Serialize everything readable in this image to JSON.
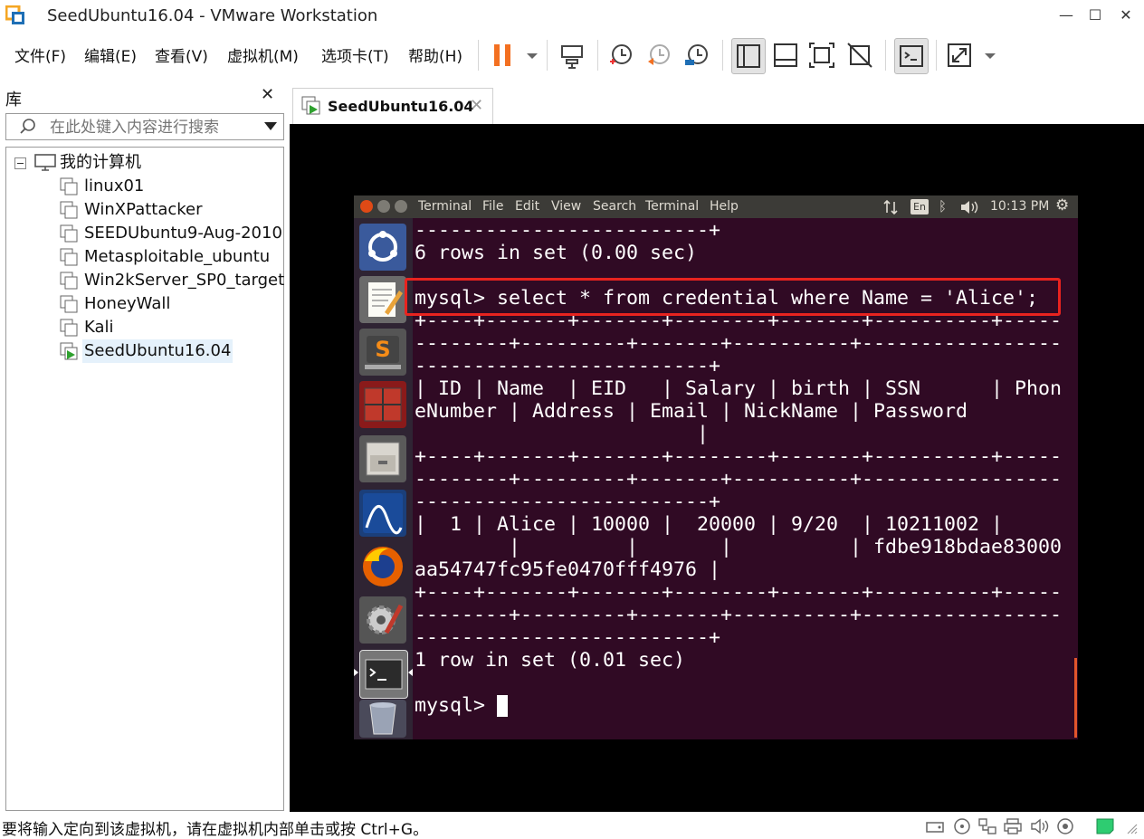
{
  "window": {
    "title": "SeedUbuntu16.04 - VMware Workstation",
    "controls": {
      "minimize": "—",
      "maximize": "☐",
      "close": "✕"
    }
  },
  "menu": [
    "文件(F)",
    "编辑(E)",
    "查看(V)",
    "虚拟机(M)",
    "选项卡(T)",
    "帮助(H)"
  ],
  "library": {
    "title": "库",
    "close": "✕",
    "search_placeholder": "在此处键入内容进行搜索",
    "root": "我的计算机",
    "vms": [
      "linux01",
      "WinXPattacker",
      "SEEDUbuntu9-Aug-2010",
      "Metasploitable_ubuntu",
      "Win2kServer_SP0_target",
      "HoneyWall",
      "Kali",
      "SeedUbuntu16.04"
    ],
    "selected": "SeedUbuntu16.04"
  },
  "tab": {
    "label": "SeedUbuntu16.04",
    "close": "✕"
  },
  "guest": {
    "panel_menus": [
      "Terminal",
      "File",
      "Edit",
      "View",
      "Search",
      "Terminal",
      "Help"
    ],
    "keyboard": "En",
    "clock": "10:13 PM",
    "terminal_lines": [
      "-------------------------+",
      "6 rows in set (0.00 sec)",
      "",
      "mysql> select * from credential where Name = 'Alice';",
      "+----+-------+-------+--------+-------+----------+-----",
      "--------+---------+-------+----------+-----------------",
      "-------------------------+",
      "| ID | Name  | EID   | Salary | birth | SSN      | Phon",
      "eNumber | Address | Email | NickName | Password",
      "                        |",
      "+----+-------+-------+--------+-------+----------+-----",
      "--------+---------+-------+----------+-----------------",
      "-------------------------+",
      "|  1 | Alice | 10000 |  20000 | 9/20  | 10211002 |",
      "        |         |       |          | fdbe918bdae83000",
      "aa54747fc95fe0470fff4976 |",
      "+----+-------+-------+--------+-------+----------+-----",
      "--------+---------+-------+----------+-----------------",
      "-------------------------+",
      "1 row in set (0.01 sec)",
      "",
      "mysql> "
    ]
  },
  "status": {
    "text": "要将输入定向到该虚拟机，请在虚拟机内部单击或按 Ctrl+G。"
  },
  "colors": {
    "terminal_bg": "#300a24",
    "highlight": "#e8231f",
    "accent_orange": "#f37021"
  }
}
